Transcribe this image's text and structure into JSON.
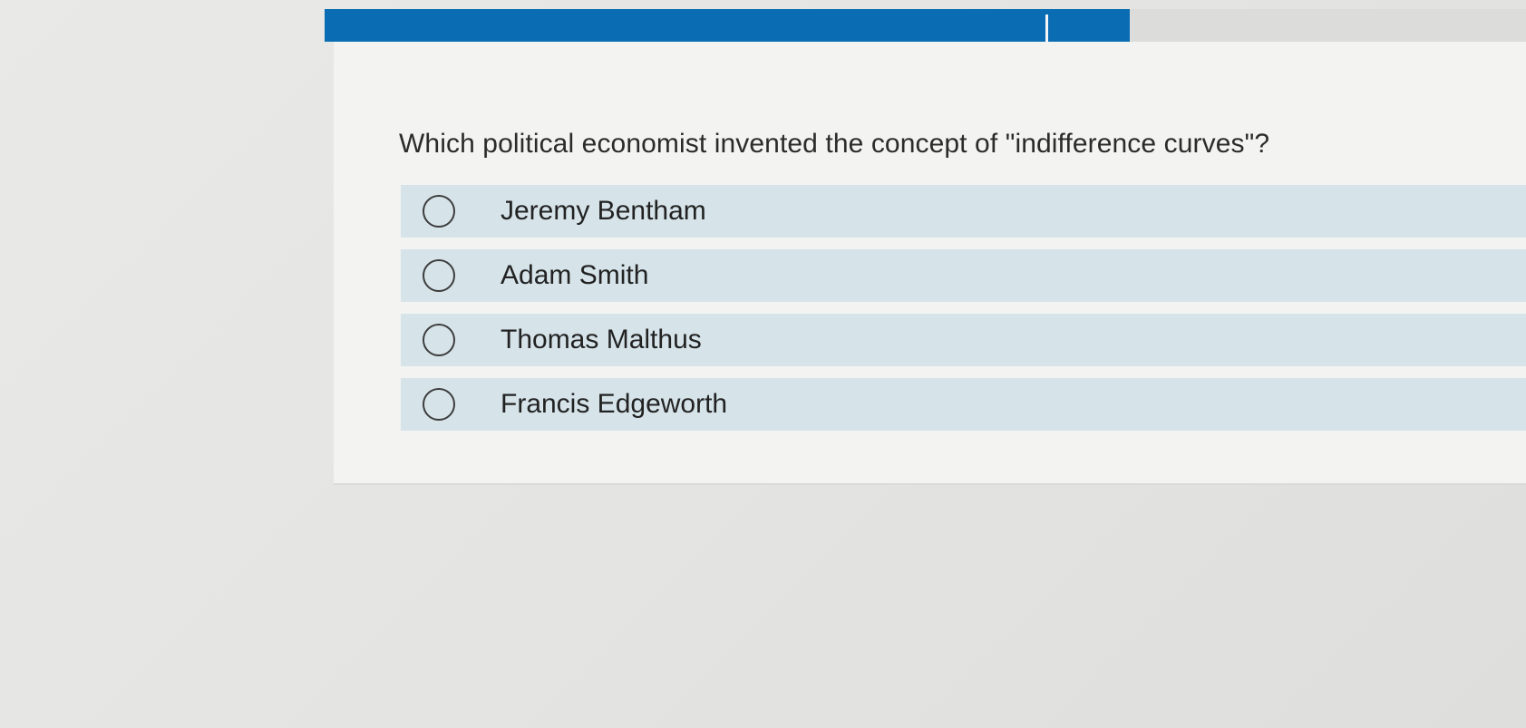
{
  "progress": {
    "fraction": 0.67,
    "color": "#0a6db3"
  },
  "question": {
    "text": "Which political economist invented the concept of \"indifference curves\"?"
  },
  "options": [
    {
      "label": "Jeremy Bentham",
      "selected": false
    },
    {
      "label": "Adam Smith",
      "selected": false
    },
    {
      "label": "Thomas Malthus",
      "selected": false
    },
    {
      "label": "Francis Edgeworth",
      "selected": false
    }
  ]
}
